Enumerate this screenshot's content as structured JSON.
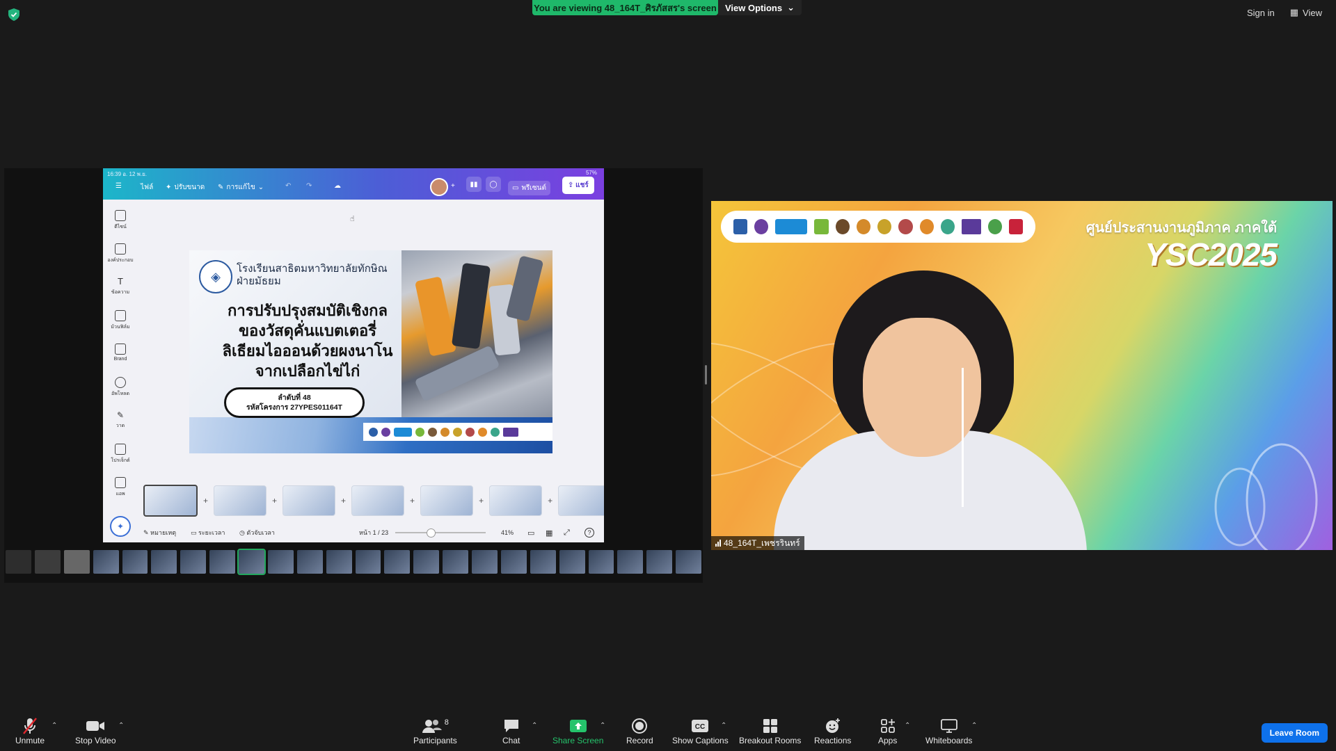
{
  "meeting": {
    "viewing_banner": "You are viewing 48_164T_ศิรภัสสร's screen",
    "view_options": "View Options",
    "sign_in": "Sign in",
    "view": "View"
  },
  "ipad": {
    "status_time": "16:39 อ. 12 พ.ย.",
    "battery": "57%",
    "menu_file": "ไฟล์",
    "menu_resize": "ปรับขนาด",
    "menu_edit": "การแก้ไข",
    "present": "พรีเซนต์",
    "share": "แชร์",
    "side_tools": [
      {
        "label": "ดีไซน์",
        "icon": "design-icon"
      },
      {
        "label": "องค์ประกอบ",
        "icon": "elements-icon"
      },
      {
        "label": "ข้อความ",
        "icon": "text-icon"
      },
      {
        "label": "ม้วนฟิล์ม",
        "icon": "camera-roll-icon"
      },
      {
        "label": "Brand",
        "icon": "brand-icon"
      },
      {
        "label": "อัพโหลด",
        "icon": "upload-icon"
      },
      {
        "label": "วาด",
        "icon": "draw-icon"
      },
      {
        "label": "โปรเจ็กต์",
        "icon": "projects-icon"
      },
      {
        "label": "แอพ",
        "icon": "apps-icon"
      }
    ],
    "notes": "หมายเหตุ",
    "duration": "ระยะเวลา",
    "timer": "ตัวจับเวลา",
    "page": "หน้า 1 / 23",
    "zoom": "41%",
    "help": "?"
  },
  "slide": {
    "school_line1": "โรงเรียนสาธิตมหาวิทยาลัยทักษิณ",
    "school_line2": "ฝ่ายมัธยม",
    "title_line1": "การปรับปรุงสมบัติเชิงกล",
    "title_line2": "ของวัสดุคั่นแบตเตอรี่",
    "title_line3": "ลิเธียมไอออนด้วยผงนาโน",
    "title_line4": "จากเปลือกไข่ไก่",
    "order": "ลำดับที่ 48",
    "project_code": "รหัสโครงการ 27YPES01164T"
  },
  "video": {
    "region": "ศูนย์ประสานงานภูมิภาค ภาคใต้",
    "brand": "YSC2025",
    "name": "48_164T_เพชรรินทร์"
  },
  "toolbar": {
    "unmute": "Unmute",
    "stop_video": "Stop Video",
    "participants": "Participants",
    "participants_count": "8",
    "chat": "Chat",
    "share_screen": "Share Screen",
    "record": "Record",
    "show_captions": "Show Captions",
    "breakout_rooms": "Breakout Rooms",
    "reactions": "Reactions",
    "apps": "Apps",
    "whiteboards": "Whiteboards",
    "leave_room": "Leave Room"
  },
  "colors": {
    "banner_green": "#1fb86a",
    "leave_blue": "#0e71eb",
    "share_green": "#25c36b"
  }
}
